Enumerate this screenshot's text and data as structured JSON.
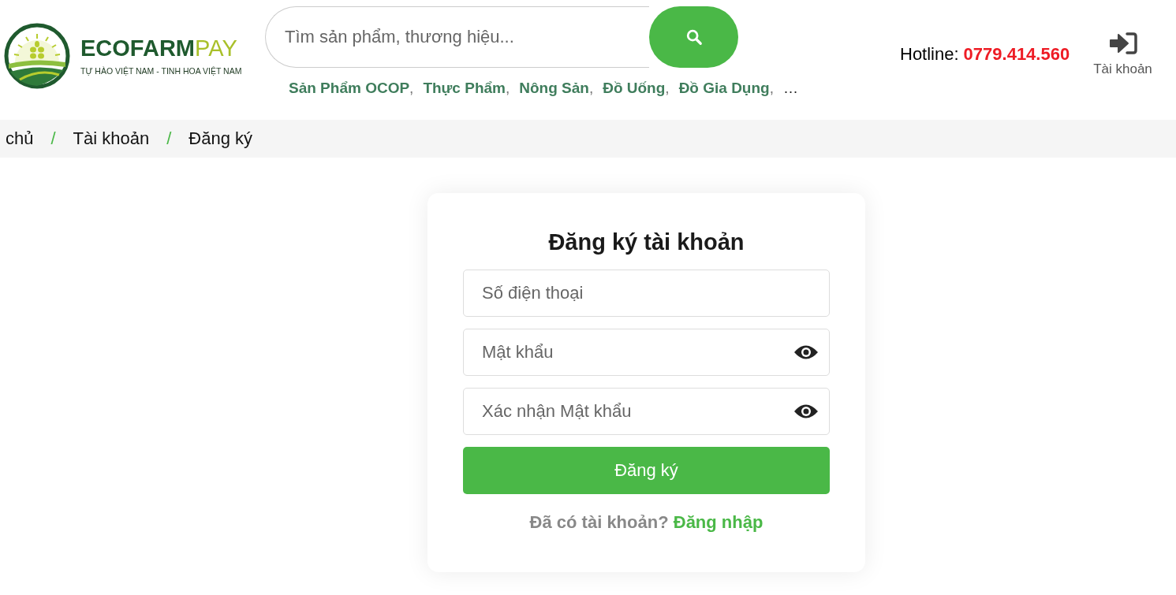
{
  "brand": {
    "main": "ECOFARM",
    "accent": "PAY",
    "tagline": "TỰ HÀO VIỆT NAM - TINH HOA VIỆT NAM"
  },
  "search": {
    "placeholder": "Tìm sản phẩm, thương hiệu..."
  },
  "categories": [
    {
      "label": "Sản Phẩm OCOP",
      "separator": ","
    },
    {
      "label": "Thực Phẩm",
      "separator": ","
    },
    {
      "label": "Nông Sản",
      "separator": ","
    },
    {
      "label": "Đồ Uống",
      "separator": ","
    },
    {
      "label": "Đồ Gia Dụng",
      "separator": ","
    }
  ],
  "categories_more": "…",
  "hotline": {
    "label": "Hotline:",
    "number": "0779.414.560"
  },
  "account": {
    "label": "Tài khoản"
  },
  "breadcrumb": [
    {
      "label": "chủ"
    },
    {
      "label": "Tài khoản"
    },
    {
      "label": "Đăng ký"
    }
  ],
  "breadcrumb_separator": "/",
  "form": {
    "title": "Đăng ký tài khoản",
    "fields": [
      {
        "placeholder": "Số điện thoại",
        "kind": "text"
      },
      {
        "placeholder": "Mật khẩu",
        "kind": "password"
      },
      {
        "placeholder": "Xác nhận Mật khẩu",
        "kind": "password"
      }
    ],
    "submit": "Đăng ký",
    "footer": {
      "question": "Đã có tài khoản?",
      "link": "Đăng nhập"
    }
  }
}
